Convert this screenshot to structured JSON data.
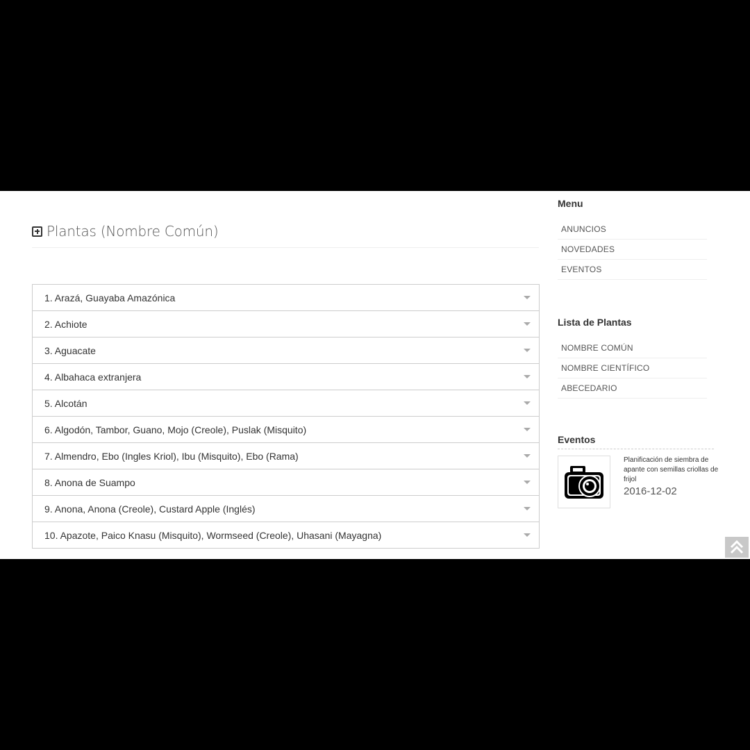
{
  "page": {
    "title": "Plantas (Nombre Común)"
  },
  "plants": [
    "1. Arazá, Guayaba Amazónica",
    "2. Achiote",
    "3. Aguacate",
    "4. Albahaca extranjera",
    "5. Alcotán",
    "6. Algodón, Tambor, Guano, Mojo (Creole), Puslak (Misquito)",
    "7. Almendro, Ebo (Ingles Kriol), Ibu (Misquito), Ebo (Rama)",
    "8. Anona de Suampo",
    "9. Anona, Anona (Creole), Custard Apple (Inglés)",
    "10. Apazote, Paico Knasu (Misquito), Wormseed (Creole), Uhasani (Mayagna)"
  ],
  "sidebar": {
    "menu": {
      "heading": "Menu",
      "items": [
        "ANUNCIOS",
        "NOVEDADES",
        "EVENTOS"
      ]
    },
    "plant_list": {
      "heading": "Lista de Plantas",
      "items": [
        "NOMBRE COMÚN",
        "NOMBRE CIENTÍFICO",
        "ABECEDARIO"
      ]
    },
    "events": {
      "heading": "Eventos",
      "item": {
        "title": "Planificación de siembra de apante con semillas criollas de frijol",
        "date": "2016-12-02",
        "icon": "camera-icon"
      }
    }
  },
  "icons": {
    "title": "plus-square-icon",
    "row_toggle": "caret-down-icon",
    "scroll_top": "double-chevron-up-icon"
  }
}
